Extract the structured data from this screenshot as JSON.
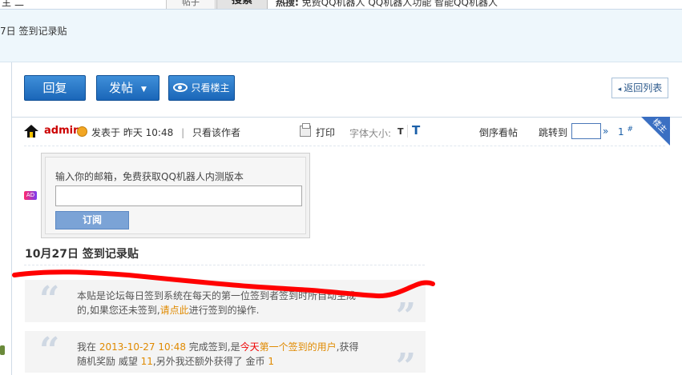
{
  "topbar": {
    "fragment1": "主",
    "fragment2": "二",
    "search_select_label": "帖子",
    "search_button": "搜索",
    "hot_label": "热搜:",
    "hot_links": "免费QQ机器人  QQ机器人功能  智能QQ机器人"
  },
  "breadcrumb": "7日 签到记录贴",
  "toolbar": {
    "reply_label": "回复",
    "post_label": "发帖",
    "author_only_label": "只看楼主",
    "back_list_label": "返回列表"
  },
  "post": {
    "author": "admin",
    "posted_label": "发表于",
    "posted_time": "昨天 10:48",
    "only_author_label": "只看该作者",
    "print_label": "打印",
    "font_size_label": "字体大小:",
    "font_small": "T",
    "font_big": "T",
    "reverse_label": "倒序看帖",
    "jump_label": "跳转到",
    "jump_arrow": "»",
    "floor_number": "1",
    "floor_mark": "#",
    "corner_badge": "楼主"
  },
  "ad": {
    "badge": "AD",
    "prompt": "输入你的邮箱，免费获取QQ机器人内测版本",
    "email_value": "",
    "subscribe_label": "订阅"
  },
  "thread_title": "10月27日 签到记录贴",
  "quote1": {
    "text_a": "本贴是论坛每日签到系统在每天的第一位签到者签到时所自动生成的,如果您还未签到,",
    "link": "请点此",
    "text_b": "进行签到的操作."
  },
  "quote2": {
    "prefix": "我在 ",
    "datetime": "2013-10-27 10:48",
    "mid1": " 完成签到,是",
    "today": "今天",
    "first_user": "第一个签到的用户",
    "mid2": ",获得随机奖励 威望 ",
    "prestige": "11",
    "mid3": ",另外我还额外获得了 金币 ",
    "coins": "1"
  },
  "colors": {
    "accent_blue": "#1a66b8",
    "username_red": "#cc0000",
    "highlight_red": "#ee0000",
    "highlight_orange": "#e08a00",
    "scribble_red": "#ff0000"
  }
}
